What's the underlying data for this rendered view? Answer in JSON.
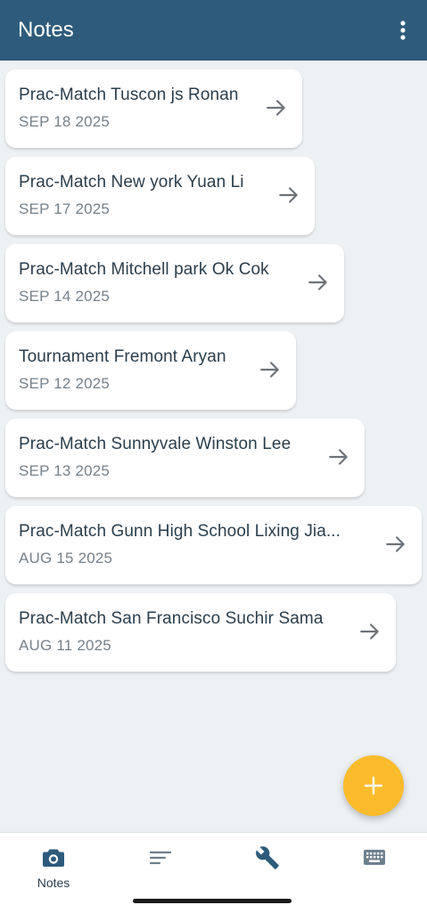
{
  "app_bar": {
    "title": "Notes",
    "menu_icon": "more-vert-icon"
  },
  "notes": [
    {
      "title": "Prac-Match Tuscon js Ronan",
      "date": "SEP 18 2025"
    },
    {
      "title": "Prac-Match New york Yuan Li",
      "date": "SEP 17 2025"
    },
    {
      "title": "Prac-Match Mitchell park Ok Cok",
      "date": "SEP 14 2025"
    },
    {
      "title": "Tournament Fremont Aryan",
      "date": "SEP 12 2025"
    },
    {
      "title": "Prac-Match Sunnyvale Winston Lee",
      "date": "SEP 13 2025"
    },
    {
      "title": "Prac-Match Gunn High School Lixing Jia...",
      "date": "AUG 15 2025"
    },
    {
      "title": "Prac-Match San Francisco Suchir Sama",
      "date": "AUG 11 2025"
    }
  ],
  "fab": {
    "icon": "plus-icon"
  },
  "bottom_nav": {
    "items": [
      {
        "label": "Notes",
        "icon": "camera-icon",
        "active": true
      },
      {
        "label": "",
        "icon": "sort-icon",
        "active": false
      },
      {
        "label": "",
        "icon": "wrench-icon",
        "active": false
      },
      {
        "label": "",
        "icon": "keyboard-icon",
        "active": false
      }
    ]
  },
  "colors": {
    "app_bar": "#2e5b7b",
    "background": "#eef1f4",
    "fab": "#fbbb2b",
    "title_text": "#2b3e4c",
    "date_text": "#76818a"
  }
}
